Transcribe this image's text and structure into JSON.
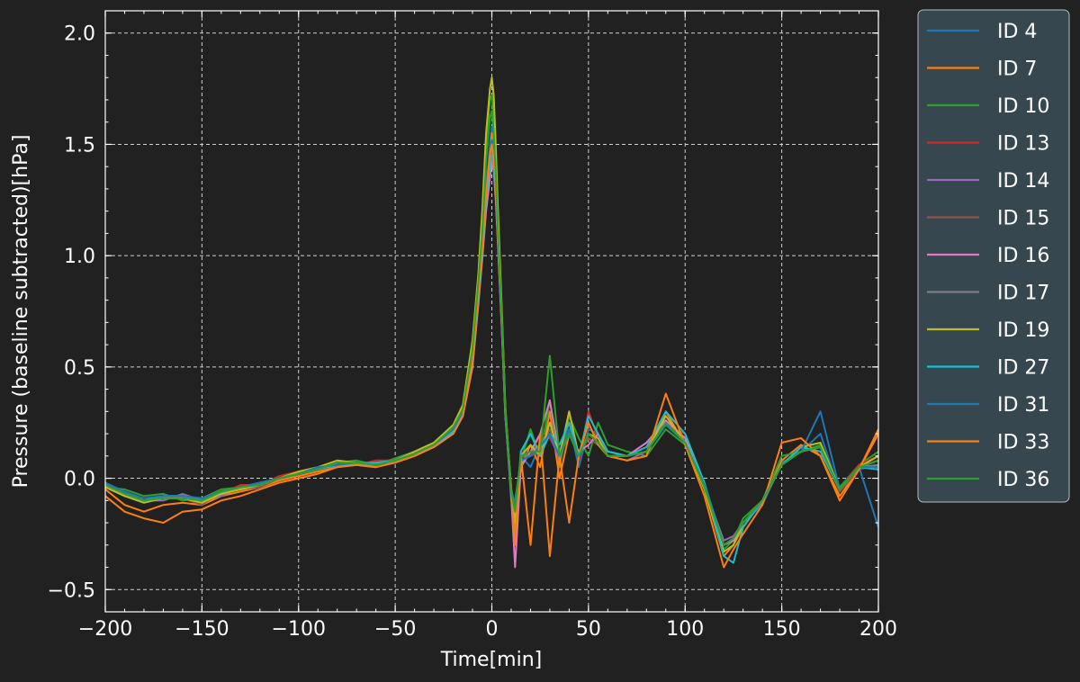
{
  "chart_data": {
    "type": "line",
    "xlabel": "Time[min]",
    "ylabel": "Pressure (baseline subtracted)[hPa]",
    "xlim": [
      -200,
      200
    ],
    "ylim": [
      -0.6,
      2.1
    ],
    "xticks": [
      -200,
      -150,
      -100,
      -50,
      0,
      50,
      100,
      150,
      200
    ],
    "xtick_labels": [
      "−200",
      "−150",
      "−100",
      "−50",
      "0",
      "50",
      "100",
      "150",
      "200"
    ],
    "yticks": [
      -0.5,
      0.0,
      0.5,
      1.0,
      1.5,
      2.0
    ],
    "ytick_labels": [
      "−0.5",
      "0.0",
      "0.5",
      "1.0",
      "1.5",
      "2.0"
    ],
    "grid": true,
    "legend_position": "outside-right",
    "background": "#212121",
    "legend_background": "#37474f",
    "x": [
      -200,
      -190,
      -180,
      -170,
      -160,
      -150,
      -140,
      -130,
      -120,
      -110,
      -100,
      -90,
      -80,
      -70,
      -60,
      -50,
      -40,
      -30,
      -20,
      -15,
      -10,
      -7,
      -5,
      -3,
      -1,
      0,
      1,
      2,
      3,
      5,
      7,
      10,
      12,
      15,
      20,
      25,
      30,
      35,
      40,
      45,
      50,
      55,
      60,
      70,
      80,
      90,
      100,
      110,
      120,
      125,
      130,
      140,
      150,
      160,
      170,
      180,
      190,
      200
    ],
    "series": [
      {
        "name": "ID 4",
        "color": "#1f77b4",
        "values": [
          -0.03,
          -0.06,
          -0.1,
          -0.08,
          -0.09,
          -0.1,
          -0.06,
          -0.05,
          -0.03,
          -0.01,
          0.02,
          0.04,
          0.06,
          0.07,
          0.06,
          0.08,
          0.11,
          0.15,
          0.22,
          0.3,
          0.55,
          0.85,
          1.05,
          1.3,
          1.5,
          1.58,
          1.5,
          1.35,
          1.15,
          0.75,
          0.3,
          -0.1,
          -0.15,
          0.1,
          0.05,
          0.15,
          0.2,
          0.12,
          0.25,
          0.05,
          0.22,
          0.2,
          0.12,
          0.1,
          0.12,
          0.26,
          0.18,
          -0.02,
          -0.3,
          -0.27,
          -0.2,
          -0.12,
          0.07,
          0.12,
          0.2,
          -0.06,
          0.05,
          -0.22
        ]
      },
      {
        "name": "ID 7",
        "color": "#ff7f0e",
        "values": [
          -0.05,
          -0.12,
          -0.15,
          -0.12,
          -0.11,
          -0.12,
          -0.08,
          -0.06,
          -0.04,
          -0.01,
          0.01,
          0.03,
          0.05,
          0.06,
          0.05,
          0.07,
          0.1,
          0.14,
          0.2,
          0.28,
          0.5,
          0.8,
          1.0,
          1.25,
          1.45,
          1.55,
          1.45,
          1.3,
          1.1,
          0.72,
          0.28,
          -0.05,
          -0.25,
          0.05,
          0.15,
          0.05,
          0.3,
          0.0,
          0.2,
          0.12,
          0.18,
          0.15,
          0.1,
          0.08,
          0.1,
          0.3,
          0.15,
          -0.05,
          -0.35,
          -0.3,
          -0.22,
          -0.1,
          0.08,
          0.15,
          0.1,
          -0.08,
          0.04,
          0.2
        ]
      },
      {
        "name": "ID 10",
        "color": "#2ca02c",
        "values": [
          -0.04,
          -0.05,
          -0.08,
          -0.07,
          -0.1,
          -0.09,
          -0.05,
          -0.04,
          -0.02,
          0.0,
          0.02,
          0.04,
          0.07,
          0.08,
          0.06,
          0.09,
          0.12,
          0.16,
          0.24,
          0.32,
          0.6,
          0.9,
          1.15,
          1.5,
          1.7,
          1.72,
          1.6,
          1.42,
          1.2,
          0.78,
          0.32,
          -0.08,
          -0.1,
          0.08,
          0.22,
          0.1,
          0.35,
          0.05,
          0.28,
          0.18,
          0.1,
          0.25,
          0.15,
          0.12,
          0.1,
          0.22,
          0.15,
          -0.03,
          -0.32,
          -0.28,
          -0.18,
          -0.1,
          0.1,
          0.12,
          0.15,
          -0.04,
          0.06,
          0.12
        ]
      },
      {
        "name": "ID 13",
        "color": "#d62728",
        "values": [
          -0.02,
          -0.07,
          -0.09,
          -0.09,
          -0.08,
          -0.11,
          -0.07,
          -0.03,
          -0.03,
          0.01,
          0.03,
          0.05,
          0.06,
          0.06,
          0.08,
          0.08,
          0.12,
          0.14,
          0.21,
          0.3,
          0.56,
          0.84,
          1.06,
          1.32,
          1.48,
          1.52,
          1.44,
          1.3,
          1.12,
          0.74,
          0.3,
          -0.06,
          -0.2,
          0.12,
          0.1,
          0.2,
          0.18,
          0.1,
          0.3,
          0.08,
          0.3,
          0.18,
          0.12,
          0.1,
          0.14,
          0.24,
          0.2,
          -0.05,
          -0.3,
          -0.28,
          -0.2,
          -0.1,
          0.06,
          0.14,
          0.12,
          -0.05,
          0.06,
          0.1
        ]
      },
      {
        "name": "ID 14",
        "color": "#9467bd",
        "values": [
          -0.03,
          -0.08,
          -0.1,
          -0.1,
          -0.07,
          -0.1,
          -0.08,
          -0.04,
          -0.02,
          0.0,
          0.02,
          0.05,
          0.05,
          0.07,
          0.07,
          0.07,
          0.1,
          0.15,
          0.21,
          0.29,
          0.52,
          0.82,
          1.02,
          1.28,
          1.42,
          1.48,
          1.42,
          1.28,
          1.1,
          0.72,
          0.3,
          -0.05,
          -0.18,
          0.1,
          0.12,
          0.15,
          0.2,
          0.08,
          0.22,
          0.1,
          0.2,
          0.16,
          0.1,
          0.08,
          0.12,
          0.25,
          0.16,
          -0.04,
          -0.28,
          -0.26,
          -0.2,
          -0.11,
          0.06,
          0.12,
          0.14,
          -0.05,
          0.05,
          0.08
        ]
      },
      {
        "name": "ID 15",
        "color": "#8c564b",
        "values": [
          -0.04,
          -0.08,
          -0.1,
          -0.09,
          -0.09,
          -0.12,
          -0.06,
          -0.05,
          -0.04,
          0.0,
          0.02,
          0.04,
          0.06,
          0.07,
          0.06,
          0.08,
          0.11,
          0.15,
          0.22,
          0.3,
          0.54,
          0.84,
          1.04,
          1.3,
          1.46,
          1.5,
          1.44,
          1.3,
          1.12,
          0.74,
          0.3,
          -0.06,
          -0.15,
          0.08,
          0.1,
          0.12,
          0.22,
          0.1,
          0.2,
          0.1,
          0.18,
          0.15,
          0.1,
          0.1,
          0.12,
          0.24,
          0.16,
          -0.04,
          -0.3,
          -0.27,
          -0.2,
          -0.1,
          0.06,
          0.12,
          0.14,
          -0.06,
          0.04,
          0.06
        ]
      },
      {
        "name": "ID 16",
        "color": "#e377c2",
        "values": [
          -0.03,
          -0.07,
          -0.1,
          -0.08,
          -0.08,
          -0.1,
          -0.07,
          -0.05,
          -0.03,
          0.0,
          0.02,
          0.04,
          0.06,
          0.06,
          0.06,
          0.08,
          0.11,
          0.14,
          0.2,
          0.28,
          0.5,
          0.78,
          0.98,
          1.2,
          1.35,
          1.42,
          1.38,
          1.25,
          1.08,
          0.7,
          0.28,
          -0.08,
          -0.4,
          0.05,
          0.12,
          0.2,
          0.35,
          0.1,
          0.2,
          0.12,
          0.15,
          0.2,
          0.12,
          0.1,
          0.16,
          0.26,
          0.18,
          -0.04,
          -0.3,
          -0.28,
          -0.2,
          -0.1,
          0.06,
          0.12,
          0.14,
          -0.05,
          0.05,
          0.08
        ]
      },
      {
        "name": "ID 17",
        "color": "#7f7f7f",
        "values": [
          -0.04,
          -0.08,
          -0.1,
          -0.09,
          -0.09,
          -0.1,
          -0.07,
          -0.04,
          -0.03,
          0.0,
          0.02,
          0.04,
          0.06,
          0.07,
          0.06,
          0.08,
          0.11,
          0.15,
          0.22,
          0.3,
          0.55,
          0.84,
          1.05,
          1.3,
          1.46,
          1.5,
          1.44,
          1.3,
          1.12,
          0.74,
          0.3,
          -0.06,
          -0.15,
          0.1,
          0.1,
          0.14,
          0.2,
          0.1,
          0.2,
          0.1,
          0.2,
          0.16,
          0.1,
          0.1,
          0.12,
          0.24,
          0.16,
          -0.04,
          -0.3,
          -0.27,
          -0.2,
          -0.1,
          0.06,
          0.12,
          0.14,
          -0.05,
          0.05,
          0.06
        ]
      },
      {
        "name": "ID 19",
        "color": "#bcbd22",
        "values": [
          -0.04,
          -0.08,
          -0.11,
          -0.09,
          -0.09,
          -0.11,
          -0.07,
          -0.05,
          -0.03,
          0.0,
          0.03,
          0.05,
          0.08,
          0.07,
          0.06,
          0.08,
          0.12,
          0.16,
          0.24,
          0.33,
          0.62,
          0.92,
          1.2,
          1.55,
          1.75,
          1.8,
          1.72,
          1.5,
          1.25,
          0.8,
          0.32,
          -0.06,
          -0.2,
          0.1,
          0.15,
          0.1,
          0.25,
          0.1,
          0.3,
          0.1,
          0.2,
          0.18,
          0.1,
          0.1,
          0.12,
          0.28,
          0.16,
          -0.05,
          -0.33,
          -0.3,
          -0.2,
          -0.1,
          0.06,
          0.14,
          0.16,
          -0.05,
          0.05,
          0.1
        ]
      },
      {
        "name": "ID 27",
        "color": "#17becf",
        "values": [
          -0.03,
          -0.07,
          -0.1,
          -0.08,
          -0.08,
          -0.1,
          -0.06,
          -0.04,
          -0.03,
          0.0,
          0.02,
          0.04,
          0.06,
          0.06,
          0.07,
          0.08,
          0.11,
          0.15,
          0.21,
          0.29,
          0.52,
          0.8,
          1.0,
          1.25,
          1.4,
          1.45,
          1.4,
          1.28,
          1.1,
          0.72,
          0.28,
          -0.06,
          -0.3,
          0.12,
          0.2,
          0.1,
          0.2,
          0.15,
          0.25,
          0.1,
          0.28,
          0.2,
          0.12,
          0.1,
          0.14,
          0.3,
          0.2,
          -0.02,
          -0.35,
          -0.38,
          -0.22,
          -0.1,
          0.06,
          0.14,
          0.12,
          -0.05,
          0.05,
          0.04
        ]
      },
      {
        "name": "ID 31",
        "color": "#1f77b4",
        "values": [
          -0.02,
          -0.06,
          -0.09,
          -0.08,
          -0.08,
          -0.09,
          -0.06,
          -0.04,
          -0.02,
          0.0,
          0.02,
          0.05,
          0.06,
          0.07,
          0.06,
          0.08,
          0.11,
          0.15,
          0.22,
          0.3,
          0.55,
          0.84,
          1.05,
          1.3,
          1.48,
          1.52,
          1.46,
          1.3,
          1.12,
          0.74,
          0.3,
          -0.05,
          -0.12,
          0.08,
          0.1,
          0.14,
          0.2,
          0.1,
          0.22,
          0.1,
          0.2,
          0.16,
          0.1,
          0.1,
          0.12,
          0.24,
          0.16,
          -0.03,
          -0.3,
          -0.27,
          -0.2,
          -0.1,
          0.06,
          0.12,
          0.3,
          -0.05,
          0.05,
          0.05
        ]
      },
      {
        "name": "ID 33",
        "color": "#ff7f0e",
        "values": [
          -0.08,
          -0.15,
          -0.18,
          -0.2,
          -0.15,
          -0.14,
          -0.1,
          -0.08,
          -0.05,
          -0.02,
          0.0,
          0.02,
          0.05,
          0.06,
          0.05,
          0.07,
          0.1,
          0.14,
          0.2,
          0.28,
          0.52,
          0.82,
          1.02,
          1.28,
          1.46,
          1.5,
          1.44,
          1.3,
          1.12,
          0.74,
          0.3,
          -0.04,
          -0.3,
          0.1,
          -0.3,
          0.2,
          -0.35,
          0.1,
          -0.2,
          0.1,
          0.25,
          0.15,
          0.1,
          0.08,
          0.1,
          0.38,
          0.15,
          -0.08,
          -0.4,
          -0.32,
          -0.25,
          -0.12,
          0.16,
          0.18,
          0.1,
          -0.1,
          0.04,
          0.22
        ]
      },
      {
        "name": "ID 36",
        "color": "#2ca02c",
        "values": [
          -0.03,
          -0.07,
          -0.1,
          -0.09,
          -0.09,
          -0.1,
          -0.06,
          -0.04,
          -0.03,
          0.0,
          0.02,
          0.04,
          0.07,
          0.07,
          0.06,
          0.08,
          0.11,
          0.15,
          0.23,
          0.31,
          0.58,
          0.88,
          1.1,
          1.42,
          1.62,
          1.65,
          1.55,
          1.38,
          1.15,
          0.76,
          0.3,
          -0.06,
          -0.15,
          0.1,
          0.12,
          0.12,
          0.55,
          0.1,
          0.2,
          0.1,
          0.2,
          0.16,
          0.1,
          0.1,
          0.12,
          0.25,
          0.16,
          -0.04,
          -0.3,
          -0.27,
          -0.2,
          -0.1,
          0.06,
          0.12,
          0.14,
          -0.05,
          0.05,
          0.08
        ]
      }
    ]
  }
}
